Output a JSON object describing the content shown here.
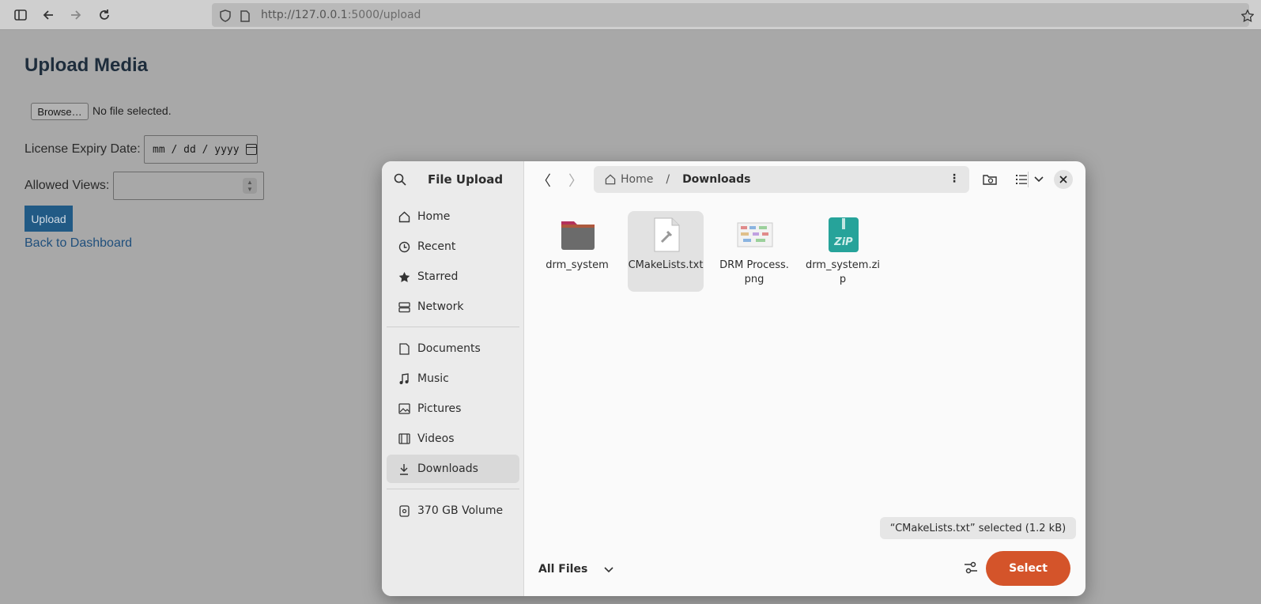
{
  "browser": {
    "url_host": "http://127.0.0.1",
    "url_path": ":5000/upload"
  },
  "page": {
    "title": "Upload Media",
    "browse_label": "Browse…",
    "no_file_text": "No file selected.",
    "expiry_label": "License Expiry Date:",
    "date_placeholder": "mm / dd / yyyy",
    "views_label": "Allowed Views:",
    "upload_label": "Upload",
    "back_link": "Back to Dashboard"
  },
  "dialog": {
    "title": "File Upload",
    "path": [
      "Home",
      "Downloads"
    ],
    "sidebar": {
      "places": [
        {
          "label": "Home",
          "icon": "home-icon"
        },
        {
          "label": "Recent",
          "icon": "clock-icon"
        },
        {
          "label": "Starred",
          "icon": "star-icon"
        },
        {
          "label": "Network",
          "icon": "network-icon"
        }
      ],
      "folders": [
        {
          "label": "Documents",
          "icon": "document-icon"
        },
        {
          "label": "Music",
          "icon": "music-icon"
        },
        {
          "label": "Pictures",
          "icon": "picture-icon"
        },
        {
          "label": "Videos",
          "icon": "video-icon"
        },
        {
          "label": "Downloads",
          "icon": "download-icon"
        }
      ],
      "volumes": [
        {
          "label": "370 GB Volume",
          "icon": "drive-icon"
        }
      ]
    },
    "files": [
      {
        "name": "drm_system",
        "type": "folder"
      },
      {
        "name": "CMakeLists.txt",
        "type": "text",
        "selected": true
      },
      {
        "name": "DRM Process.png",
        "type": "image"
      },
      {
        "name": "drm_system.zip",
        "type": "zip"
      }
    ],
    "status": "“CMakeLists.txt” selected  (1.2 kB)",
    "filter": "All Files",
    "select_label": "Select"
  },
  "colors": {
    "accent": "#d4542a",
    "upload_button": "#215a85",
    "selected_row": "#d9d9d9"
  }
}
